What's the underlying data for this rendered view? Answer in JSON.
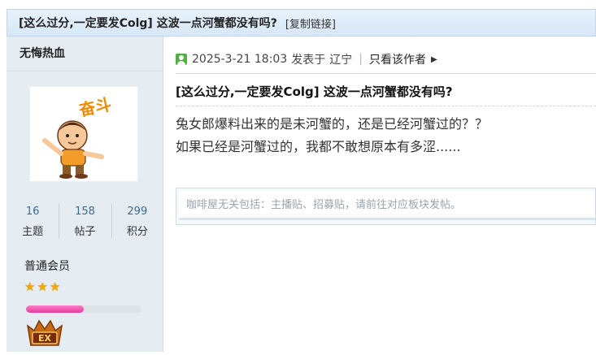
{
  "header": {
    "title": "[这么过分,一定要发Colg] 这波一点河蟹都没有吗?",
    "copy_link": "[复制链接]"
  },
  "sidebar": {
    "author": "无悔热血",
    "stats": [
      {
        "value": "16",
        "label": "主题"
      },
      {
        "value": "158",
        "label": "帖子"
      },
      {
        "value": "299",
        "label": "积分"
      }
    ],
    "user_group": "普通会员",
    "star_count": 3,
    "level_progress_percent": 50,
    "badge_text": "EX"
  },
  "post": {
    "date": "2025-3-21 18:03",
    "posted_from_label": "发表于",
    "location": "辽宁",
    "only_author_label": "只看该作者",
    "title": "[这么过分,一定要发Colg] 这波一点河蟹都没有吗?",
    "body_lines": [
      "兔女郎爆料出来的是未河蟹的，还是已经河蟹过的？？",
      "如果已经是河蟹过的，我都不敢想原本有多涩......"
    ],
    "notice": "咖啡屋无关包括：主播贴、招募贴，请前往对应板块发帖。"
  },
  "colors": {
    "header_bg": "#dbe9f7",
    "sidebar_bg": "#e5edf2",
    "stat_number": "#3b6a93",
    "star": "#f2a900",
    "progress_fill": "#e23d9c",
    "user_icon_green": "#52b043"
  },
  "icons": [
    "user-icon",
    "triangle-right-icon",
    "star-icon",
    "level-badge-icon"
  ]
}
